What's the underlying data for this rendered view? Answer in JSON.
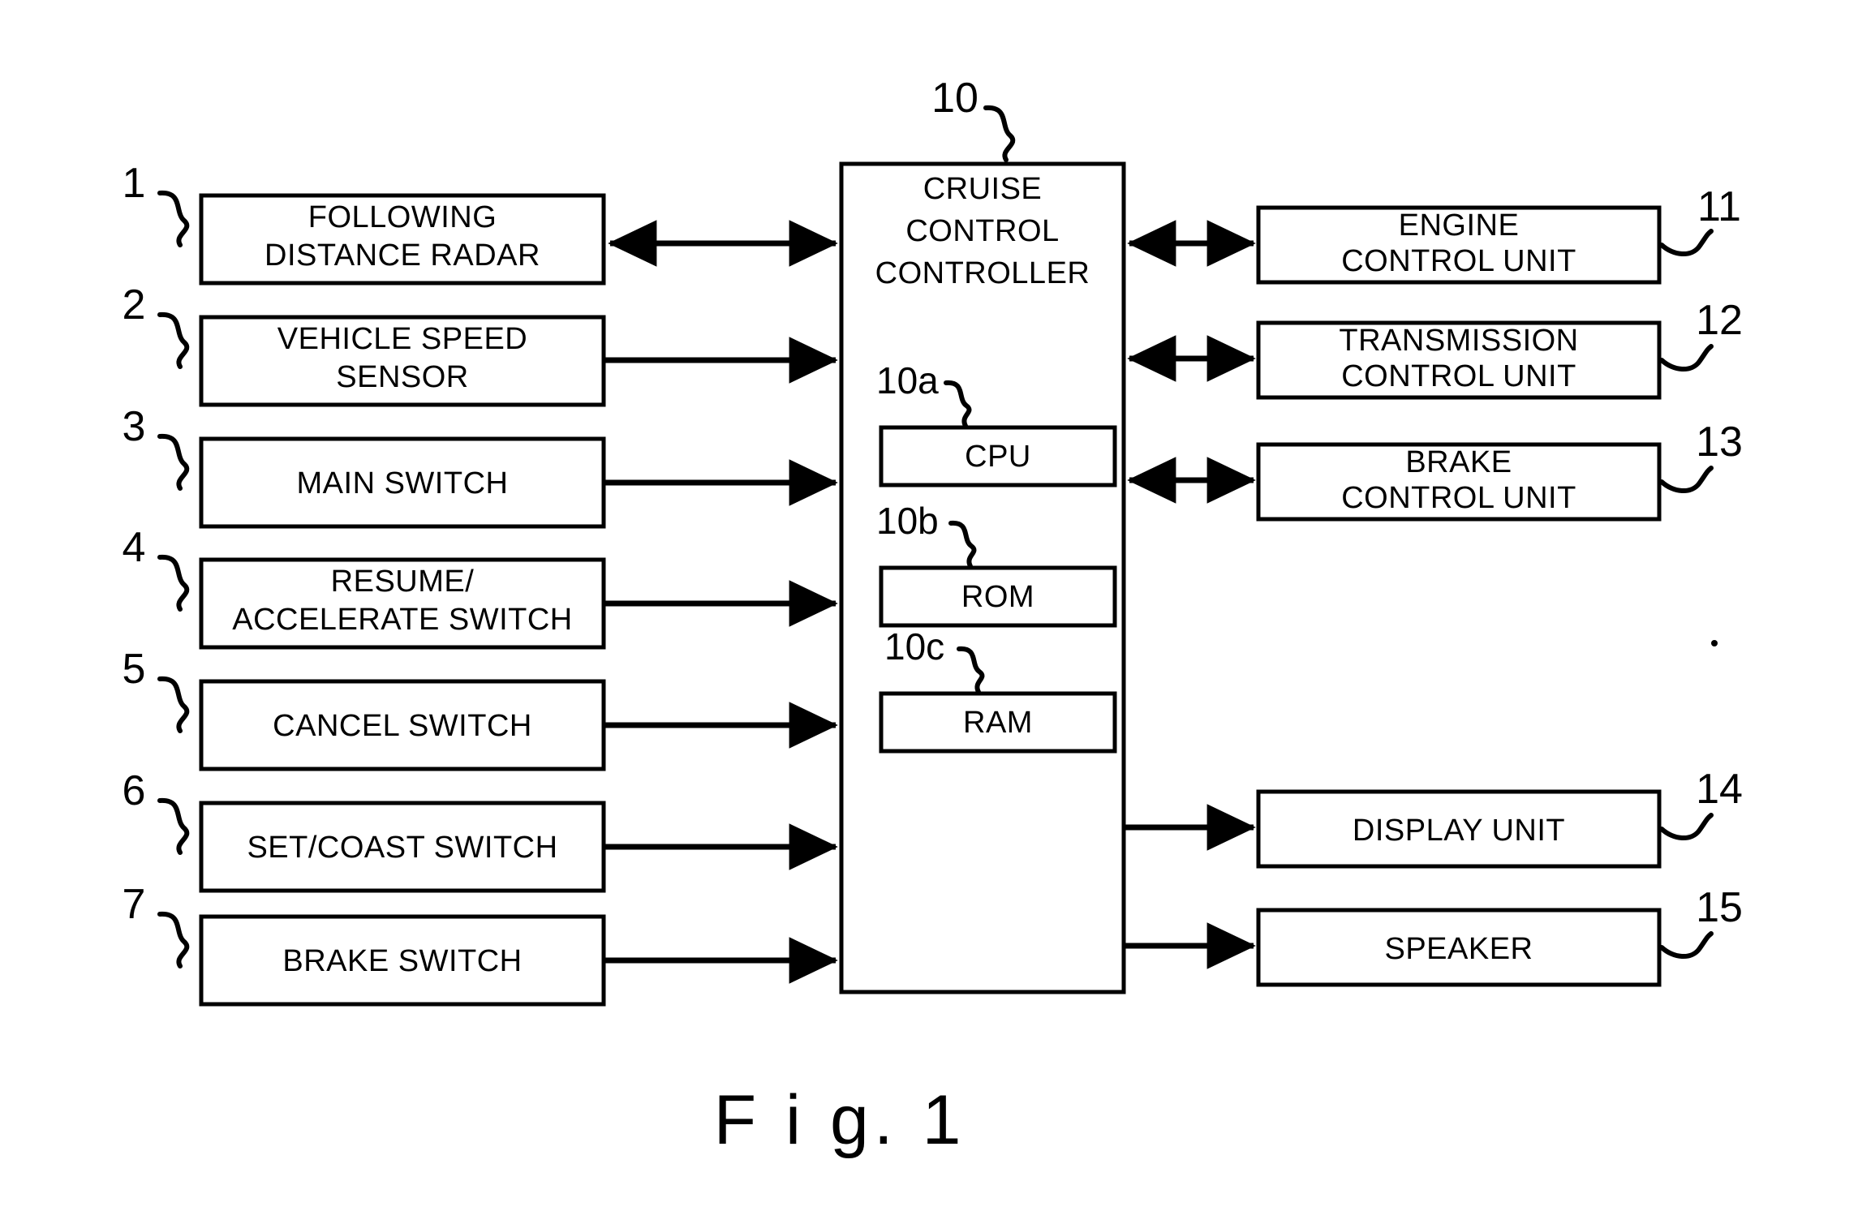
{
  "figure": {
    "caption": "F i g. 1"
  },
  "central_unit": {
    "ref": "10",
    "title_lines": [
      "CRUISE",
      "CONTROL",
      "CONTROLLER"
    ],
    "components": [
      {
        "ref": "10a",
        "label": "CPU"
      },
      {
        "ref": "10b",
        "label": "ROM"
      },
      {
        "ref": "10c",
        "label": "RAM"
      }
    ]
  },
  "inputs": [
    {
      "ref": "1",
      "lines": [
        "FOLLOWING",
        "DISTANCE RADAR"
      ],
      "arrow": "bidirectional"
    },
    {
      "ref": "2",
      "lines": [
        "VEHICLE SPEED",
        "SENSOR"
      ],
      "arrow": "to-controller"
    },
    {
      "ref": "3",
      "lines": [
        "MAIN SWITCH"
      ],
      "arrow": "to-controller"
    },
    {
      "ref": "4",
      "lines": [
        "RESUME/",
        "ACCELERATE SWITCH"
      ],
      "arrow": "to-controller"
    },
    {
      "ref": "5",
      "lines": [
        "CANCEL SWITCH"
      ],
      "arrow": "to-controller"
    },
    {
      "ref": "6",
      "lines": [
        "SET/COAST SWITCH"
      ],
      "arrow": "to-controller"
    },
    {
      "ref": "7",
      "lines": [
        "BRAKE SWITCH"
      ],
      "arrow": "to-controller"
    }
  ],
  "outputs": [
    {
      "ref": "11",
      "lines": [
        "ENGINE",
        "CONTROL UNIT"
      ],
      "arrow": "bidirectional"
    },
    {
      "ref": "12",
      "lines": [
        "TRANSMISSION",
        "CONTROL UNIT"
      ],
      "arrow": "bidirectional"
    },
    {
      "ref": "13",
      "lines": [
        "BRAKE",
        "CONTROL UNIT"
      ],
      "arrow": "bidirectional"
    },
    {
      "ref": "14",
      "lines": [
        "DISPLAY UNIT"
      ],
      "arrow": "from-controller"
    },
    {
      "ref": "15",
      "lines": [
        "SPEAKER"
      ],
      "arrow": "from-controller"
    }
  ],
  "colors": {
    "ink": "#000000",
    "paper": "#ffffff"
  }
}
